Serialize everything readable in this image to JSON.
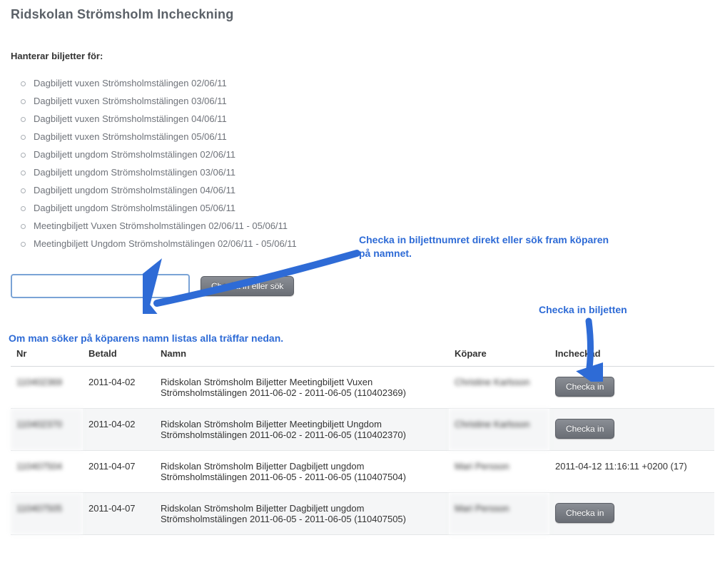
{
  "page": {
    "title": "Ridskolan Strömsholm Incheckning",
    "managing_label": "Hanterar biljetter för:"
  },
  "ticketTypes": [
    "Dagbiljett vuxen Strömsholmstälingen 02/06/11",
    "Dagbiljett vuxen Strömsholmstälingen 03/06/11",
    "Dagbiljett vuxen Strömsholmstälingen 04/06/11",
    "Dagbiljett vuxen Strömsholmstälingen 05/06/11",
    "Dagbiljett ungdom Strömsholmstälingen 02/06/11",
    "Dagbiljett ungdom Strömsholmstälingen 03/06/11",
    "Dagbiljett ungdom Strömsholmstälingen 04/06/11",
    "Dagbiljett ungdom Strömsholmstälingen 05/06/11",
    "Meetingbiljett Vuxen Strömsholmstälingen 02/06/11 - 05/06/11",
    "Meetingbiljett Ungdom Strömsholmstälingen 02/06/11 - 05/06/11"
  ],
  "search": {
    "value": "",
    "button": "Checka in eller sök"
  },
  "annotations": {
    "arrow1": "Checka in biljettnumret direkt eller sök fram köparen på namnet.",
    "arrow2": "Checka in biljetten",
    "below": "Om man söker på köparens namn listas alla träffar nedan."
  },
  "table": {
    "headers": {
      "nr": "Nr",
      "paid": "Betald",
      "name": "Namn",
      "buyer": "Köpare",
      "checked": "Incheckad"
    },
    "checkin_label": "Checka in",
    "rows": [
      {
        "nr": "110402369",
        "paid": "2011-04-02",
        "name": "Ridskolan Strömsholm Biljetter Meetingbiljett Vuxen Strömsholmstälingen 2011-06-02 - 2011-06-05 (110402369)",
        "buyer": "Christine Karlsson",
        "checked": null
      },
      {
        "nr": "110402370",
        "paid": "2011-04-02",
        "name": "Ridskolan Strömsholm Biljetter Meetingbiljett Ungdom Strömsholmstälingen 2011-06-02 - 2011-06-05 (110402370)",
        "buyer": "Christine Karlsson",
        "checked": null
      },
      {
        "nr": "110407504",
        "paid": "2011-04-07",
        "name": "Ridskolan Strömsholm Biljetter Dagbiljett ungdom Strömsholmstälingen 2011-06-05 - 2011-06-05 (110407504)",
        "buyer": "Mari Persson",
        "checked": "2011-04-12 11:16:11 +0200 (17)"
      },
      {
        "nr": "110407505",
        "paid": "2011-04-07",
        "name": "Ridskolan Strömsholm Biljetter Dagbiljett ungdom Strömsholmstälingen 2011-06-05 - 2011-06-05 (110407505)",
        "buyer": "Mari Persson",
        "checked": null
      }
    ]
  }
}
